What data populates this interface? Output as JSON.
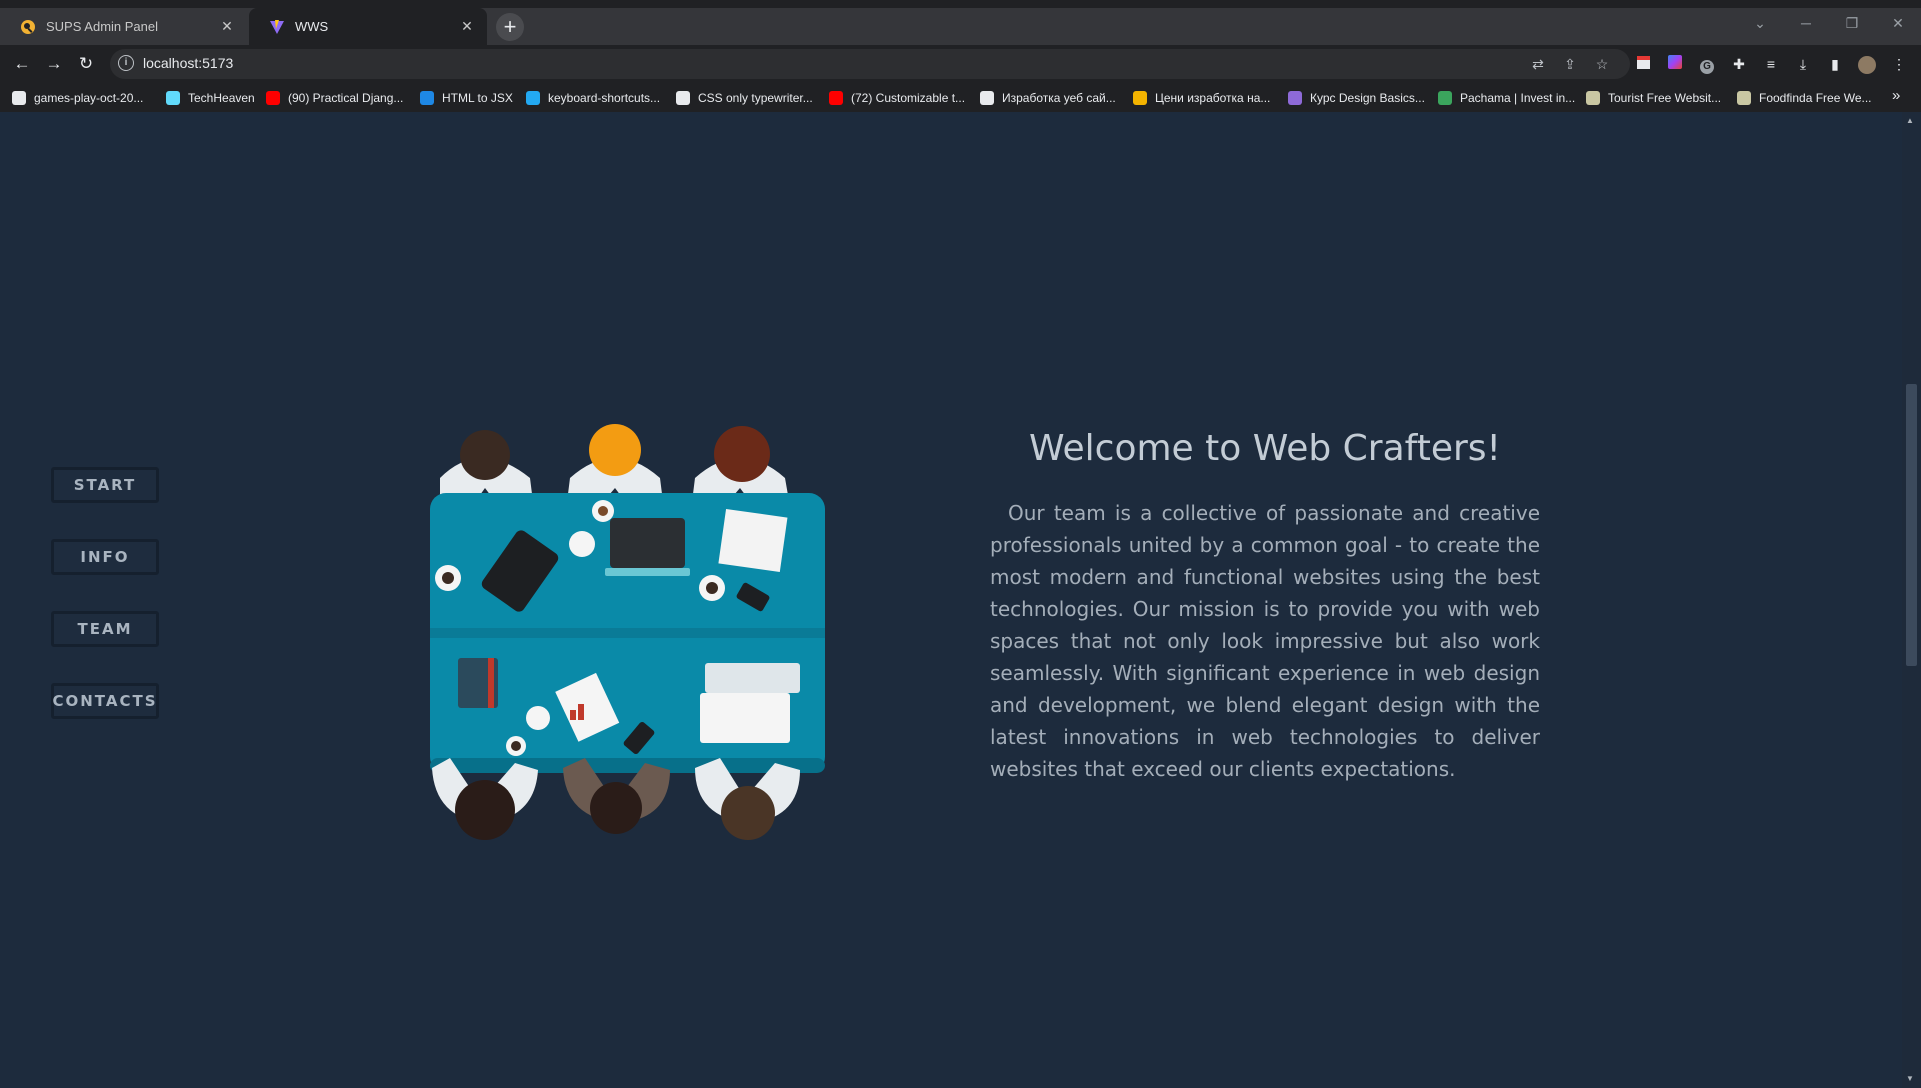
{
  "browser": {
    "tabs": [
      {
        "label": "SUPS Admin Panel",
        "active": false
      },
      {
        "label": "WWS",
        "active": true
      }
    ],
    "new_tab_label": "+",
    "url": "localhost:5173",
    "bookmarks": [
      {
        "label": "games-play-oct-20...",
        "icon": "github-icon",
        "color": "#e8eaed"
      },
      {
        "label": "TechHeaven",
        "icon": "react-icon",
        "color": "#61dafb"
      },
      {
        "label": "(90) Practical Djang...",
        "icon": "youtube-icon",
        "color": "#ff0000"
      },
      {
        "label": "HTML to JSX",
        "icon": "transform-icon",
        "color": "#1e88e5"
      },
      {
        "label": "keyboard-shortcuts...",
        "icon": "vscode-icon",
        "color": "#23a9f2"
      },
      {
        "label": "CSS only typewriter...",
        "icon": "codepen-icon",
        "color": "#e8eaed"
      },
      {
        "label": "(72) Customizable t...",
        "icon": "youtube-icon",
        "color": "#ff0000"
      },
      {
        "label": "Изработка уеб сай...",
        "icon": "site-icon",
        "color": "#e8eaed"
      },
      {
        "label": "Цени изработка на...",
        "icon": "site-icon",
        "color": "#f4b400"
      },
      {
        "label": "Курс Design Basics...",
        "icon": "cap-icon",
        "color": "#8e6ad8"
      },
      {
        "label": "Pachama | Invest in...",
        "icon": "leaf-icon",
        "color": "#3ba55d"
      },
      {
        "label": "Tourist Free Websit...",
        "icon": "image-icon",
        "color": "#c9c7a3"
      },
      {
        "label": "Foodfinda Free We...",
        "icon": "image-icon",
        "color": "#c9c7a3"
      }
    ],
    "more_bookmarks": "»"
  },
  "sidenav": {
    "items": [
      "START",
      "INFO",
      "TEAM",
      "CONTACTS"
    ]
  },
  "hero": {
    "title": "Welcome to Web Crafters!",
    "text": "Our team is a collective of passionate and creative professionals united by a common goal - to create the most modern and functional websites using the best technologies. Our mission is to provide you with web spaces that not only look impressive but also work seamlessly. With significant experience in web design and development, we blend elegant design with the latest innovations in web technologies to deliver websites that exceed our clients expectations.",
    "illustration": "team-meeting-illustration"
  },
  "colors": {
    "background": "#1d2b3d",
    "table": "#0a8aa8",
    "accent_text": "#c3ccd5"
  }
}
